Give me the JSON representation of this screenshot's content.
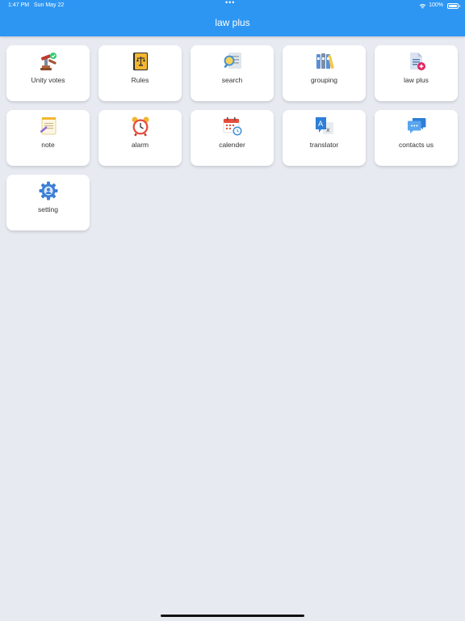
{
  "status_bar": {
    "time": "1:47 PM",
    "date": "Sun May 22",
    "dots": "•••",
    "battery": "100%"
  },
  "header": {
    "title": "law plus"
  },
  "tiles": [
    {
      "label": "Unity votes",
      "icon": "gavel-vote-icon"
    },
    {
      "label": "Rules",
      "icon": "law-book-icon"
    },
    {
      "label": "search",
      "icon": "document-search-icon"
    },
    {
      "label": "grouping",
      "icon": "binders-icon"
    },
    {
      "label": "law plus",
      "icon": "document-plus-icon"
    },
    {
      "label": "note",
      "icon": "notepad-icon"
    },
    {
      "label": "alarm",
      "icon": "alarm-clock-icon"
    },
    {
      "label": "calender",
      "icon": "calendar-clock-icon"
    },
    {
      "label": "translator",
      "icon": "translate-icon"
    },
    {
      "label": "contacts us",
      "icon": "chat-bubbles-icon"
    },
    {
      "label": "setting",
      "icon": "gear-user-icon"
    }
  ],
  "colors": {
    "header": "#2d96f3",
    "background": "#e8eaf2",
    "tile": "#ffffff"
  }
}
